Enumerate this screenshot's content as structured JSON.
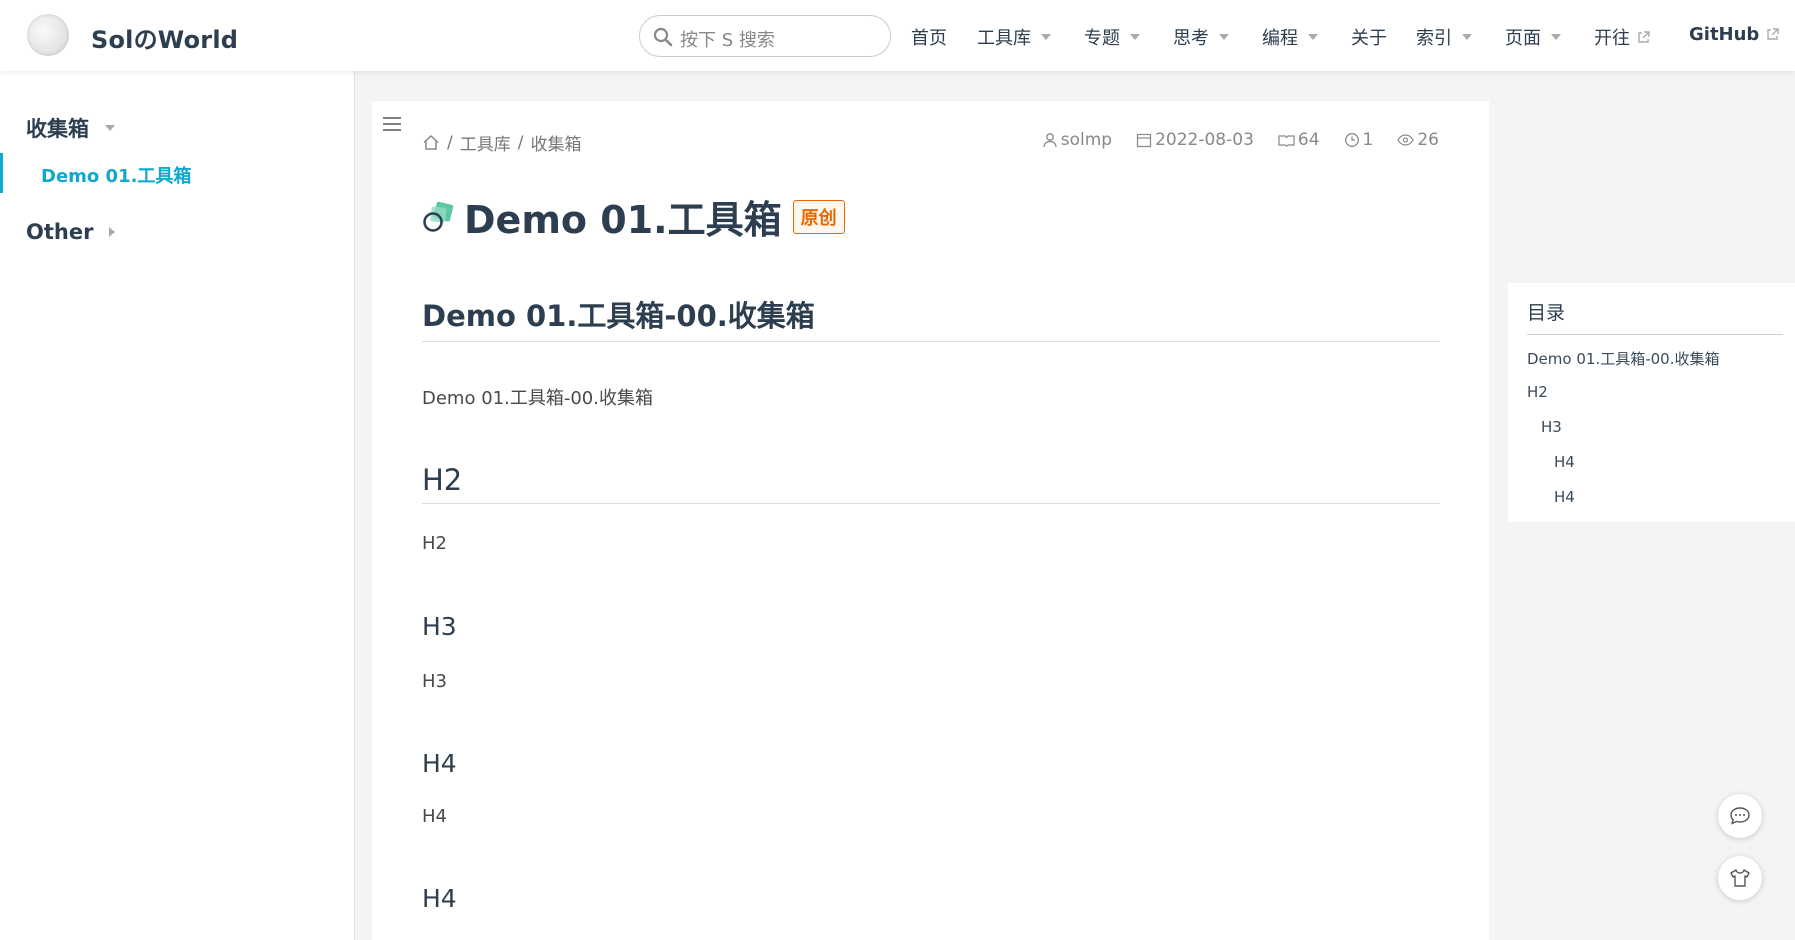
{
  "navbar": {
    "site_name": "SolのWorld",
    "search_placeholder": "按下 S 搜索",
    "items": [
      {
        "label": "首页"
      },
      {
        "label": "工具库"
      },
      {
        "label": "专题"
      },
      {
        "label": "思考"
      },
      {
        "label": "编程"
      },
      {
        "label": "关于"
      },
      {
        "label": "索引"
      },
      {
        "label": "页面"
      },
      {
        "label": "开往"
      },
      {
        "label": "GitHub"
      }
    ]
  },
  "sidebar": {
    "groups": [
      {
        "label": "收集箱",
        "items": [
          {
            "label": "Demo 01.工具箱"
          }
        ]
      },
      {
        "label": "Other"
      }
    ]
  },
  "breadcrumb": {
    "sep": "/",
    "items": [
      "工具库",
      "收集箱"
    ]
  },
  "meta": {
    "author": "solmp",
    "date": "2022-08-03",
    "words": "64",
    "read_time": "1",
    "views": "26"
  },
  "article": {
    "title": "Demo 01.工具箱",
    "badge": "原创",
    "sections": [
      {
        "heading": "Demo 01.工具箱-00.收集箱",
        "text": "Demo 01.工具箱-00.收集箱"
      },
      {
        "heading": "H2",
        "text": "H2"
      },
      {
        "heading": "H3",
        "text": "H3"
      },
      {
        "heading": "H4",
        "text": "H4"
      },
      {
        "heading": "H4"
      }
    ]
  },
  "toc": {
    "title": "目录",
    "items": [
      "Demo 01.工具箱-00.收集箱",
      "H2",
      "H3",
      "H4",
      "H4"
    ]
  },
  "colors": {
    "accent": "#11a8cd",
    "badge": "#e96900",
    "text": "#2c3e50"
  }
}
